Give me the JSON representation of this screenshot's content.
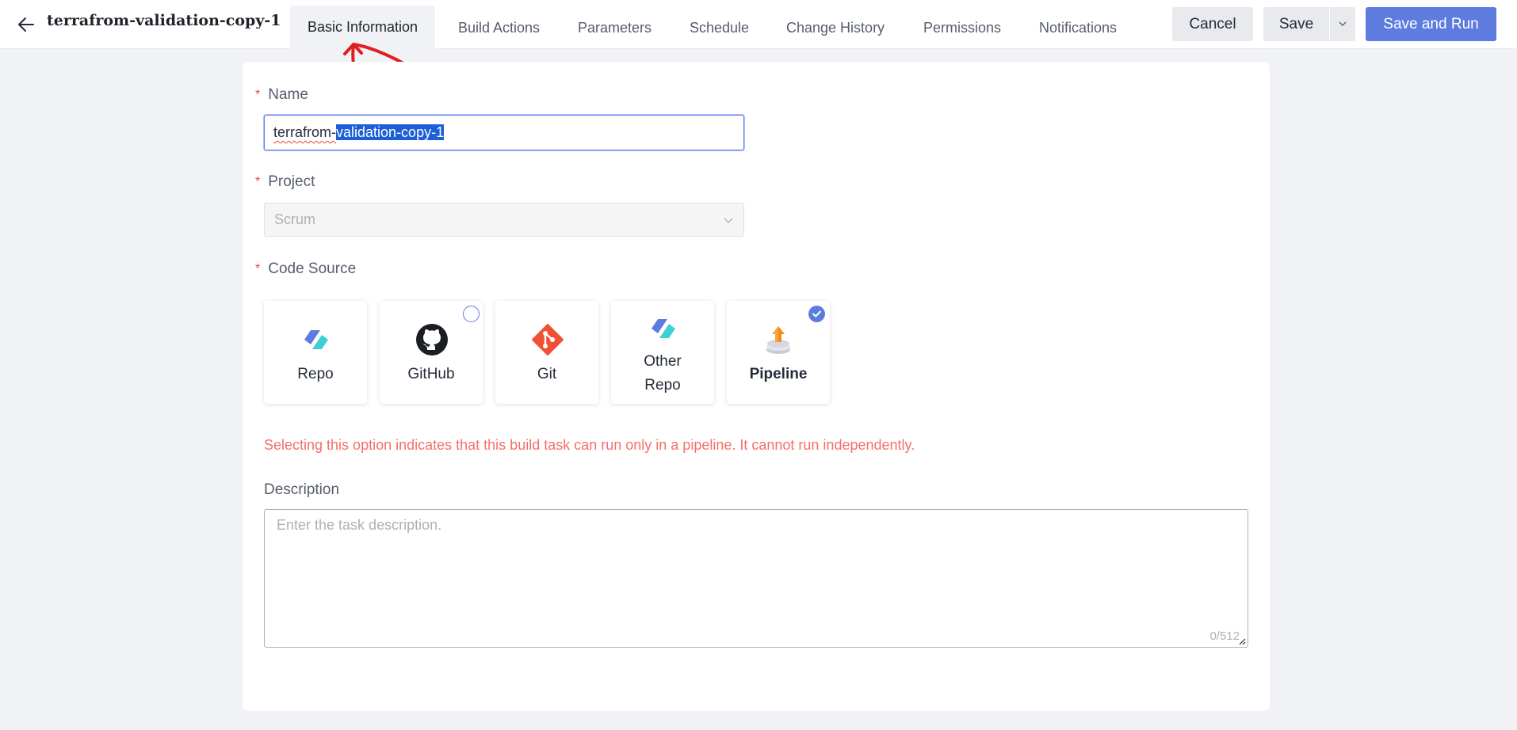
{
  "header": {
    "title": "terrafrom-validation-copy-1",
    "tabs": [
      {
        "label": "Basic Information",
        "active": true
      },
      {
        "label": "Build Actions"
      },
      {
        "label": "Parameters"
      },
      {
        "label": "Schedule"
      },
      {
        "label": "Change History"
      },
      {
        "label": "Permissions"
      },
      {
        "label": "Notifications"
      }
    ],
    "buttons": {
      "cancel": "Cancel",
      "save": "Save",
      "save_and_run": "Save and Run"
    }
  },
  "form": {
    "name": {
      "label": "Name",
      "required_mark": "*",
      "value_unselected": "terrafrom-",
      "value_selected": "validation-copy-1"
    },
    "project": {
      "label": "Project",
      "required_mark": "*",
      "value": "Scrum"
    },
    "code_source": {
      "label": "Code Source",
      "required_mark": "*",
      "options": [
        {
          "label": "Repo",
          "icon": "repo-icon"
        },
        {
          "label": "GitHub",
          "icon": "github-icon"
        },
        {
          "label": "Git",
          "icon": "git-icon"
        },
        {
          "label": "Other Repo",
          "icon": "other-repo-icon"
        },
        {
          "label": "Pipeline",
          "icon": "pipeline-icon",
          "selected": true
        }
      ],
      "hint": "Selecting this option indicates that this build task can run only in a pipeline. It cannot run independently."
    },
    "description": {
      "label": "Description",
      "placeholder": "Enter the task description.",
      "counter": "0/512"
    }
  },
  "colors": {
    "accent": "#5e7ce0",
    "error": "#f66f6a",
    "annotation": "#e02020"
  }
}
